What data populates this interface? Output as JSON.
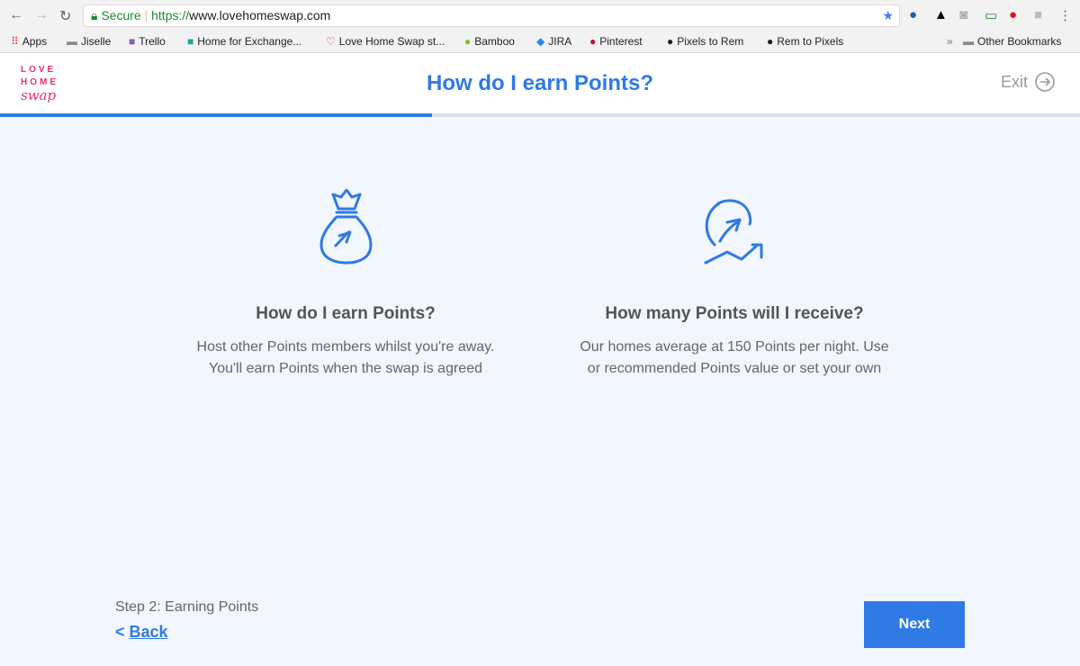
{
  "browser": {
    "secure_label": "Secure",
    "url_scheme": "https://",
    "url_host": "www.lovehomeswap.com",
    "bookmarks": [
      {
        "label": "Apps",
        "icon": "apps-grid-icon"
      },
      {
        "label": "Jiselle",
        "icon": "folder-icon"
      },
      {
        "label": "Trello",
        "icon": "trello-icon"
      },
      {
        "label": "Home for Exchange...",
        "icon": "h-icon"
      },
      {
        "label": "Love Home Swap st...",
        "icon": "heart-icon"
      },
      {
        "label": "Bamboo",
        "icon": "bamboo-icon"
      },
      {
        "label": "JIRA",
        "icon": "jira-icon"
      },
      {
        "label": "Pinterest",
        "icon": "pinterest-icon"
      },
      {
        "label": "Pixels to Rem",
        "icon": "ninja-icon"
      },
      {
        "label": "Rem to Pixels",
        "icon": "ninja-icon"
      }
    ],
    "overflow": "»",
    "other_bookmarks": "Other Bookmarks"
  },
  "header": {
    "logo": {
      "line1": "LOVE",
      "line2": "HOME",
      "line3": "swap"
    },
    "title": "How do I earn Points?",
    "exit_label": "Exit"
  },
  "progress": {
    "percent": 40
  },
  "columns": [
    {
      "icon": "money-bag-icon",
      "heading": "How do I earn Points?",
      "body": "Host other Points members whilst you're away. You'll earn Points when the swap is agreed"
    },
    {
      "icon": "growth-chart-icon",
      "heading": "How many Points will I receive?",
      "body": "Our homes average at 150 Points per night. Use or recommended Points value or set your own"
    }
  ],
  "footer": {
    "step": "Step 2: Earning Points",
    "back_chevron": "<",
    "back_label": "Back",
    "next_label": "Next"
  },
  "colors": {
    "accent": "#2f7ae5",
    "logo": "#e8336e",
    "background": "#f2f6fd"
  }
}
